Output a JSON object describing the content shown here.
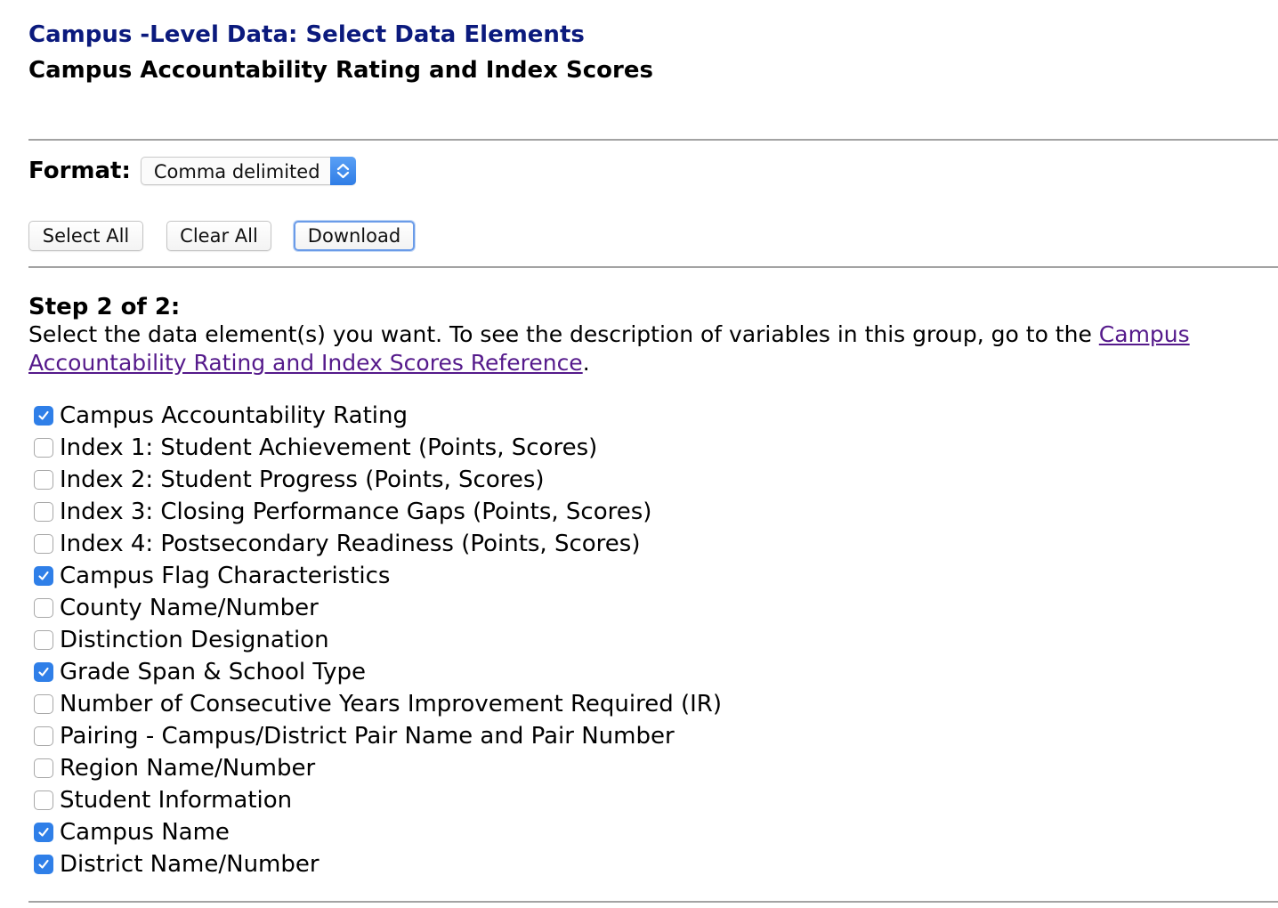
{
  "header": {
    "title": "Campus -Level Data: Select Data Elements",
    "subtitle": "Campus Accountability Rating and Index Scores"
  },
  "format": {
    "label": "Format:",
    "selected": "Comma delimited"
  },
  "buttons": {
    "select_all": "Select All",
    "clear_all": "Clear All",
    "download": "Download"
  },
  "step": {
    "heading": "Step 2 of 2:",
    "instruction_prefix": "Select the data element(s) you want. To see the description of variables in this group, go to the ",
    "reference_link": "Campus Accountability Rating and Index Scores Reference",
    "instruction_suffix": "."
  },
  "options": [
    {
      "label": "Campus Accountability Rating",
      "checked": true
    },
    {
      "label": "Index 1: Student Achievement (Points, Scores)",
      "checked": false
    },
    {
      "label": "Index 2: Student Progress (Points, Scores)",
      "checked": false
    },
    {
      "label": "Index 3: Closing Performance Gaps (Points, Scores)",
      "checked": false
    },
    {
      "label": "Index 4: Postsecondary Readiness (Points, Scores)",
      "checked": false
    },
    {
      "label": "Campus Flag Characteristics",
      "checked": true
    },
    {
      "label": "County Name/Number",
      "checked": false
    },
    {
      "label": "Distinction Designation",
      "checked": false
    },
    {
      "label": "Grade Span & School Type",
      "checked": true
    },
    {
      "label": "Number of Consecutive Years Improvement Required (IR)",
      "checked": false
    },
    {
      "label": "Pairing - Campus/District Pair Name and Pair Number",
      "checked": false
    },
    {
      "label": "Region Name/Number",
      "checked": false
    },
    {
      "label": "Student Information",
      "checked": false
    },
    {
      "label": "Campus Name",
      "checked": true
    },
    {
      "label": "District Name/Number",
      "checked": true
    }
  ],
  "colors": {
    "title_blue": "#0b1a7d",
    "link_purple": "#551a8b",
    "checkbox_blue": "#2f7fe8",
    "divider_gray": "#a3a3a3"
  }
}
